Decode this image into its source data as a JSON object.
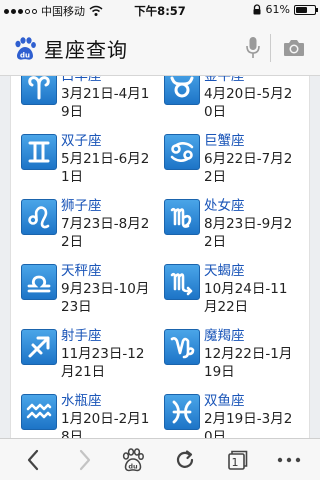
{
  "status_bar": {
    "carrier": "中国移动",
    "time": "下午8:57",
    "battery": "61%",
    "battery_level": 0.61
  },
  "search": {
    "query": "星座查询"
  },
  "signs": [
    {
      "name": "白羊座",
      "range": "3月21日-4月19日",
      "icon": "aries-icon"
    },
    {
      "name": "金牛座",
      "range": "4月20日-5月20日",
      "icon": "taurus-icon"
    },
    {
      "name": "双子座",
      "range": "5月21日-6月21日",
      "icon": "gemini-icon"
    },
    {
      "name": "巨蟹座",
      "range": "6月22日-7月22日",
      "icon": "cancer-icon"
    },
    {
      "name": "狮子座",
      "range": "7月23日-8月22日",
      "icon": "leo-icon"
    },
    {
      "name": "处女座",
      "range": "8月23日-9月22日",
      "icon": "virgo-icon"
    },
    {
      "name": "天秤座",
      "range": "9月23日-10月23日",
      "icon": "libra-icon"
    },
    {
      "name": "天蝎座",
      "range": "10月24日-11月22日",
      "icon": "scorpio-icon"
    },
    {
      "name": "射手座",
      "range": "11月23日-12月21日",
      "icon": "sagittarius-icon"
    },
    {
      "name": "魔羯座",
      "range": "12月22日-1月19日",
      "icon": "capricorn-icon"
    },
    {
      "name": "水瓶座",
      "range": "1月20日-2月18日",
      "icon": "aquarius-icon"
    },
    {
      "name": "双鱼座",
      "range": "2月19日-3月20日",
      "icon": "pisces-icon"
    }
  ],
  "toolbar": {
    "tab_count": "1"
  },
  "colors": {
    "tile_top": "#4aa5e8",
    "tile_bottom": "#1d74c7",
    "sign_name": "#1a55b8",
    "baidu_blue": "#2f5fd0"
  }
}
